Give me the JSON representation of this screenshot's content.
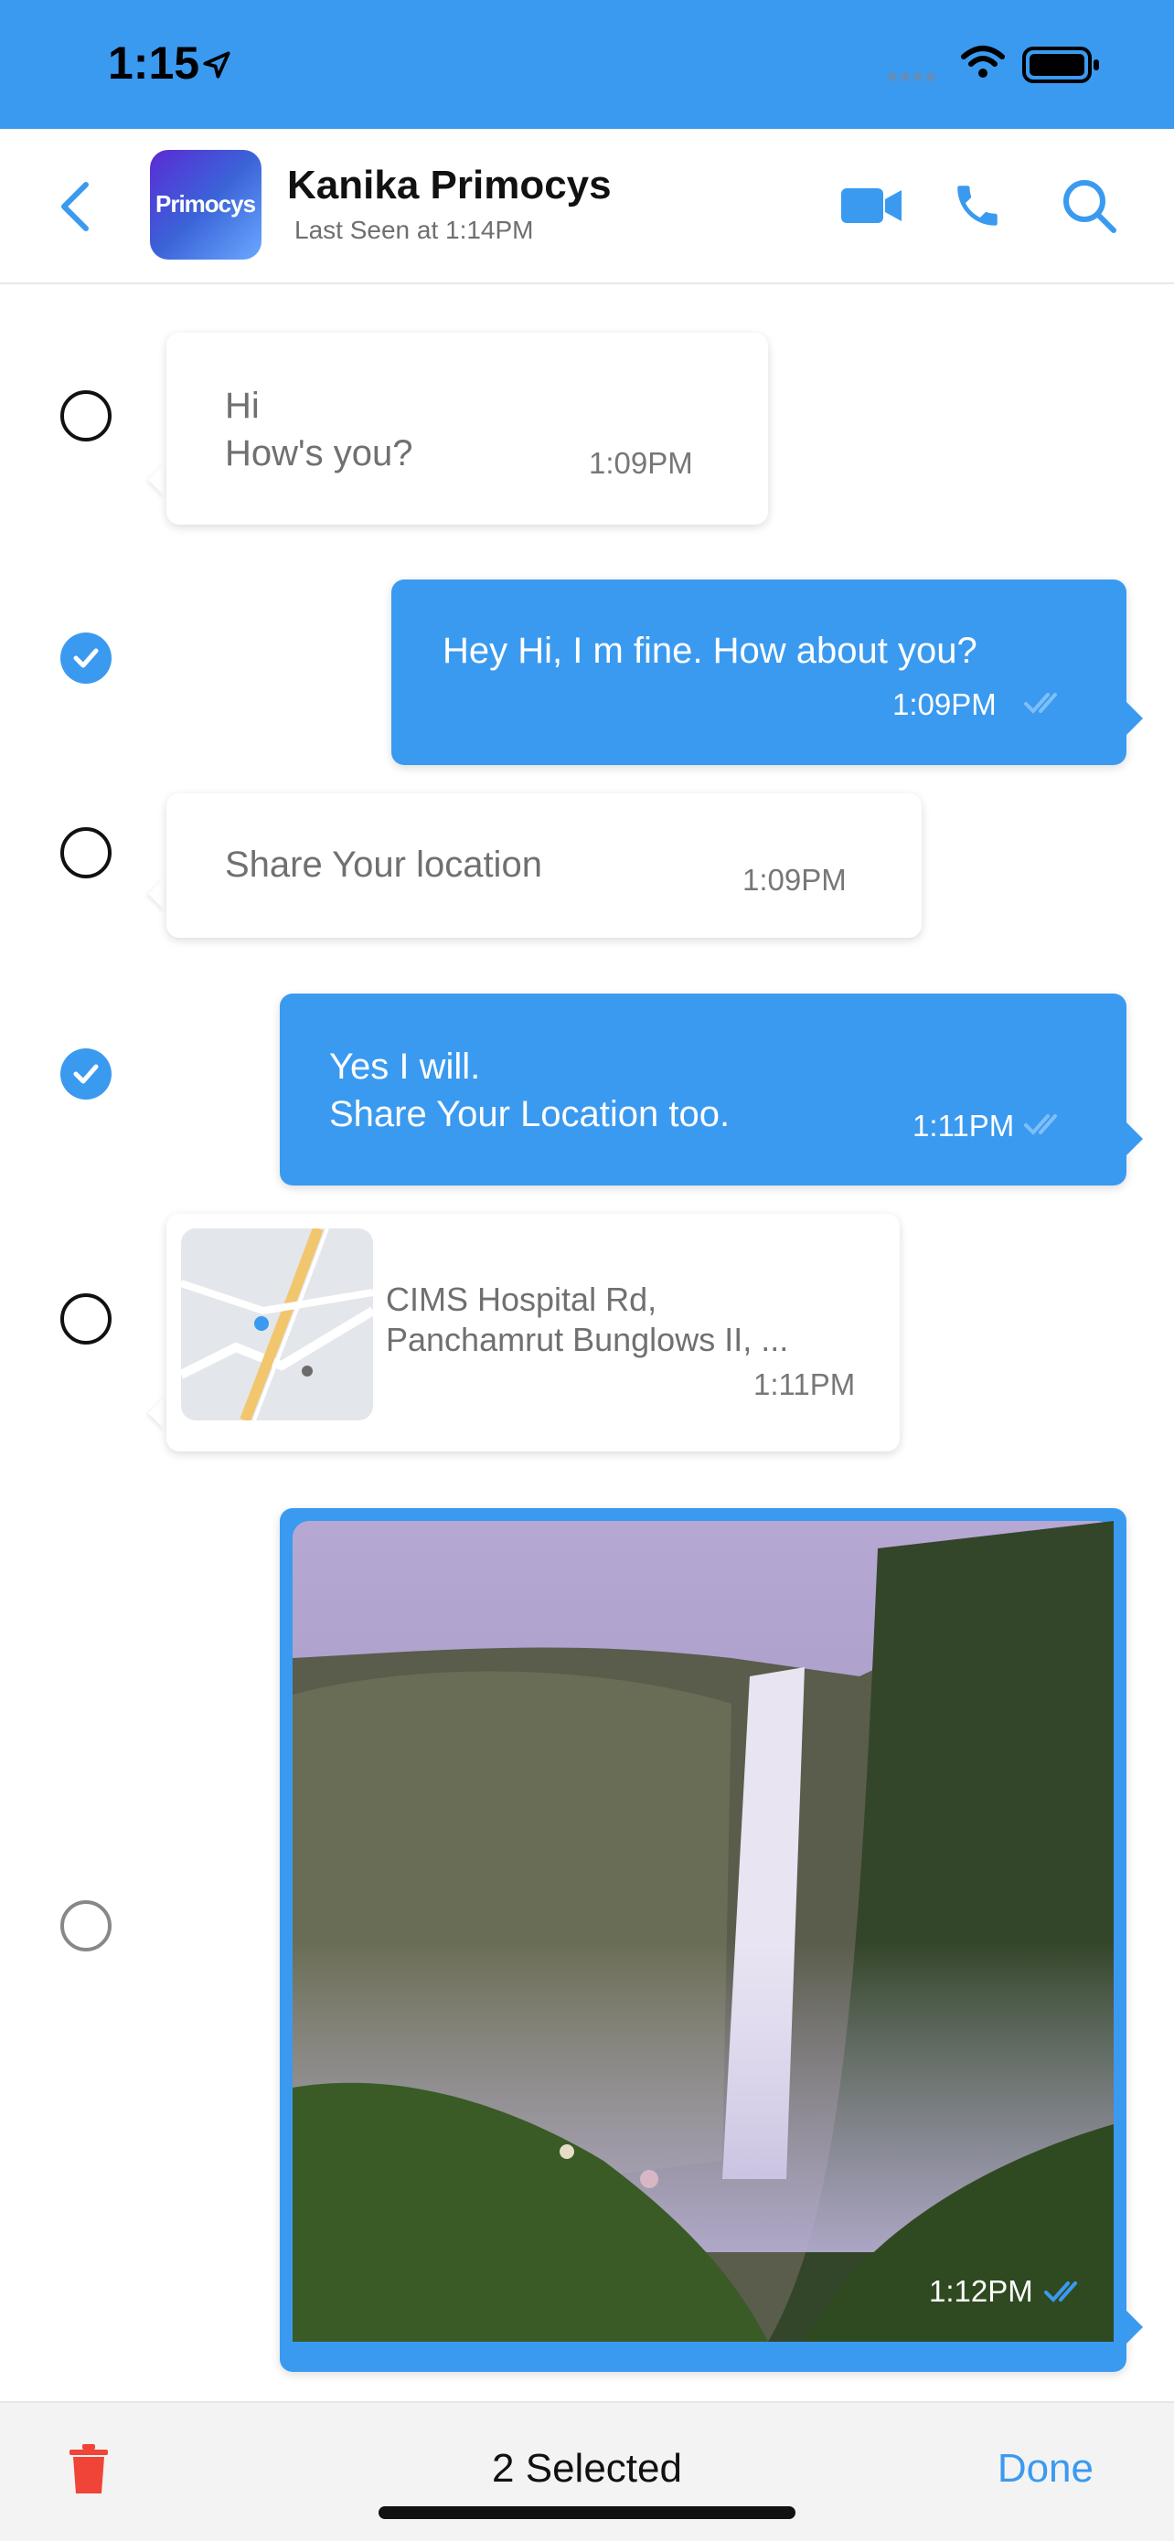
{
  "status_bar": {
    "time": "1:15"
  },
  "header": {
    "contact_name": "Kanika Primocys",
    "last_seen": "Last Seen at 1:14PM",
    "avatar_text": "Primocys"
  },
  "messages": [
    {
      "direction": "in",
      "text": [
        "Hi",
        "How's you?"
      ],
      "time": "1:09PM",
      "selected": false
    },
    {
      "direction": "out",
      "text": [
        "Hey Hi, I m fine. How about you?"
      ],
      "time": "1:09PM",
      "selected": true
    },
    {
      "direction": "in",
      "text": [
        "Share Your location"
      ],
      "time": "1:09PM",
      "selected": false
    },
    {
      "direction": "out",
      "text": [
        "Yes I will.",
        "Share Your Location too."
      ],
      "time": "1:11PM",
      "selected": true
    },
    {
      "direction": "in",
      "type": "location",
      "text": [
        "CIMS Hospital Rd,",
        "Panchamrut Bunglows II, ..."
      ],
      "time": "1:11PM",
      "selected": false
    },
    {
      "direction": "out",
      "type": "image",
      "time": "1:12PM",
      "selected": false
    }
  ],
  "bottom_bar": {
    "selected_text": "2 Selected",
    "done_label": "Done"
  },
  "colors": {
    "accent": "#3a9af0",
    "delete": "#f04438"
  },
  "icons": [
    "back-icon",
    "video-call-icon",
    "phone-icon",
    "search-icon",
    "trash-icon"
  ]
}
